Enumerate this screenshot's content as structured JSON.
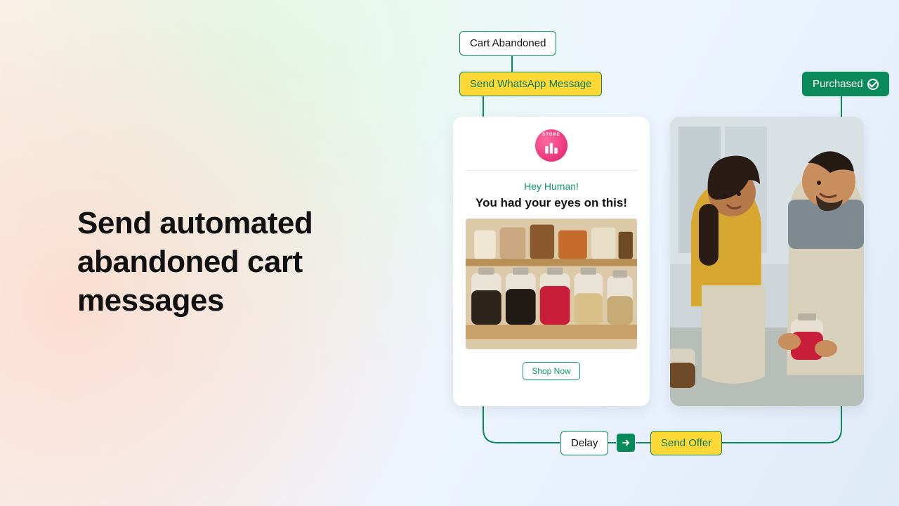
{
  "headline": "Send automated abandoned cart messages",
  "flow": {
    "trigger": "Cart Abandoned",
    "action1": "Send WhatsApp Message",
    "delay": "Delay",
    "action2": "Send Offer",
    "result": "Purchased"
  },
  "message_card": {
    "greeting": "Hey Human!",
    "subhead": "You had your eyes on this!",
    "cta": "Shop Now",
    "logo_label": "STORE"
  },
  "colors": {
    "green": "#0a8a5a",
    "yellow": "#ffd835",
    "pink": "#e11d6b"
  }
}
